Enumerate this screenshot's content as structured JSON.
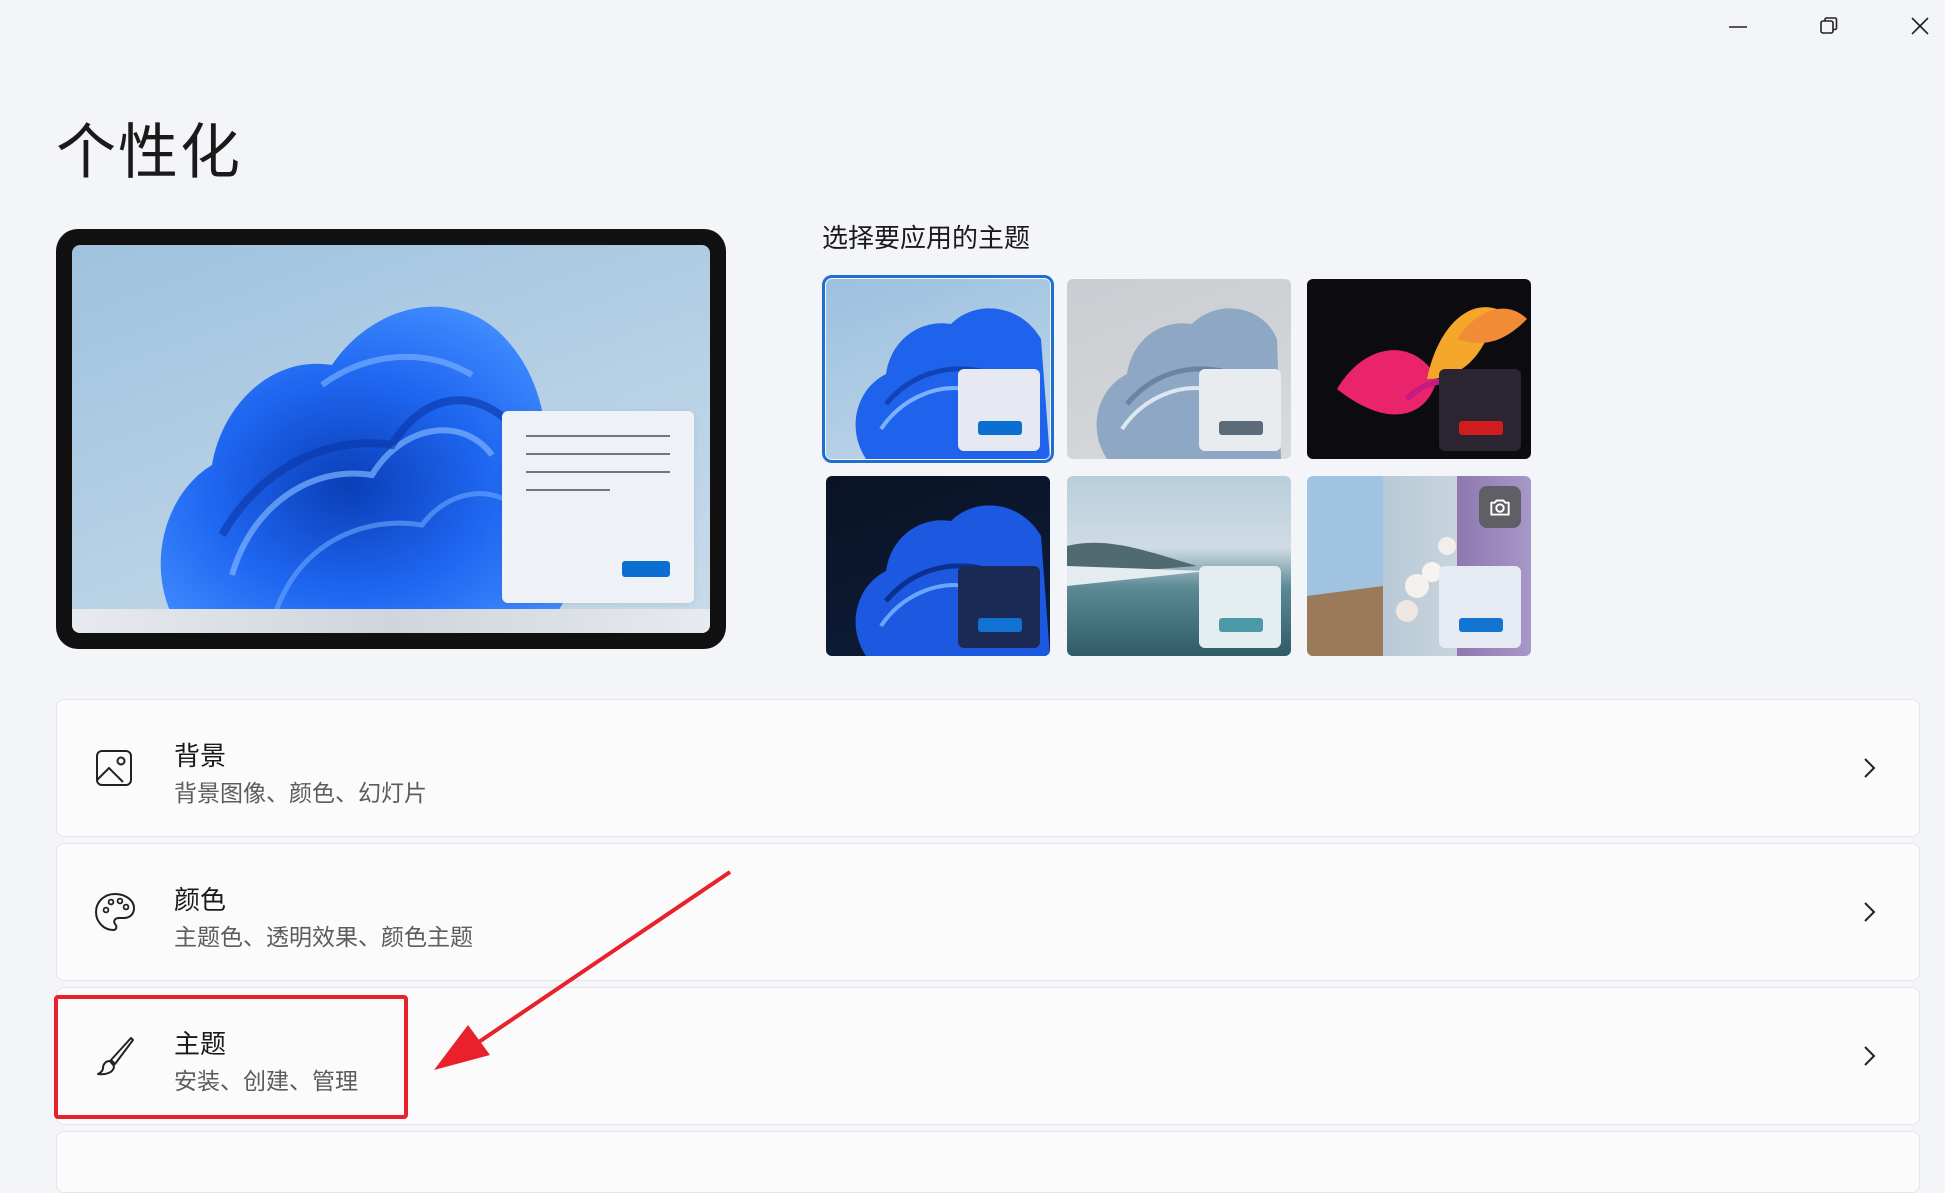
{
  "window": {
    "controls": {
      "minimize": "minimize",
      "maximize": "maximize",
      "close": "close"
    }
  },
  "page": {
    "title": "个性化"
  },
  "themes": {
    "label": "选择要应用的主题",
    "tiles": [
      {
        "name": "windows-light",
        "selected": true,
        "button_color": "#0b6fd1"
      },
      {
        "name": "glow",
        "selected": false,
        "button_color": "#5b6b7a"
      },
      {
        "name": "captured-motion",
        "selected": false,
        "button_color": "#d01c1c"
      },
      {
        "name": "windows-dark",
        "selected": false,
        "button_color": "#1172d4"
      },
      {
        "name": "sunrise",
        "selected": false,
        "button_color": "#4c9aa8"
      },
      {
        "name": "flow",
        "selected": false,
        "button_color": "#1275d4"
      }
    ]
  },
  "rows": [
    {
      "title": "背景",
      "subtitle": "背景图像、颜色、幻灯片",
      "icon": "image-icon"
    },
    {
      "title": "颜色",
      "subtitle": "主题色、透明效果、颜色主题",
      "icon": "palette-icon"
    },
    {
      "title": "主题",
      "subtitle": "安装、创建、管理",
      "icon": "brush-icon"
    }
  ],
  "colors": {
    "accent": "#1d6fd0",
    "annotation": "#e8212a"
  }
}
